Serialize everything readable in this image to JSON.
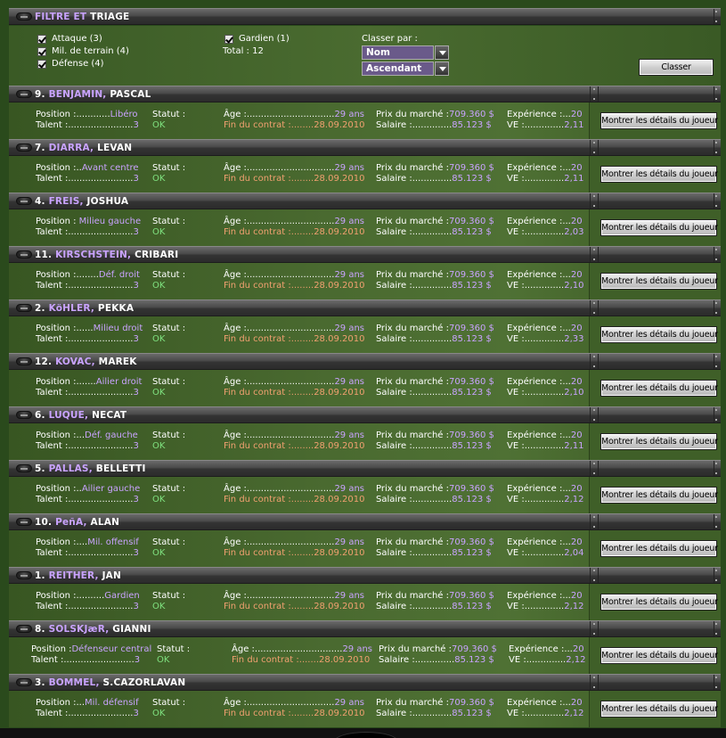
{
  "filter": {
    "title_a": "FILTRE ET",
    "title_b": "TRIAGE",
    "checks": [
      {
        "label": "Attaque (3)"
      },
      {
        "label": "Mil. de terrain (4)"
      },
      {
        "label": "Défense (4)"
      },
      {
        "label": "Gardien (1)"
      }
    ],
    "total": "Total : 12",
    "sort_label": "Classer par :",
    "sort_by": "Nom",
    "sort_order": "Ascendant",
    "sort_button": "Classer"
  },
  "details_button": "Montrer les détails du joueur",
  "players": [
    {
      "num": "9.",
      "last": "BENJAMIN,",
      "first": "PASCAL",
      "position": "Position :............Libéro",
      "talent": "Talent :.......................3",
      "statut_label": "Statut :",
      "statut": "OK",
      "age": "Âge :...............................29 ans",
      "contract": "Fin du contrat :........28.09.2010",
      "price": "Prix du marché :709.360 $",
      "salary": "Salaire :..............85.123 $",
      "exp": "Expérience :...20",
      "ve": "VE :..............2,11"
    },
    {
      "num": "7.",
      "last": "DIARRA,",
      "first": "LEVAN",
      "position": "Position :..Avant centre",
      "talent": "Talent :.......................3",
      "statut_label": "Statut :",
      "statut": "OK",
      "age": "Âge :...............................29 ans",
      "contract": "Fin du contrat :........28.09.2010",
      "price": "Prix du marché :709.360 $",
      "salary": "Salaire :..............85.123 $",
      "exp": "Expérience :...20",
      "ve": "VE :..............2,11"
    },
    {
      "num": "4.",
      "last": "FREIS,",
      "first": "JOSHUA",
      "position": "Position : Milieu gauche",
      "talent": "Talent :.......................3",
      "statut_label": "Statut :",
      "statut": "OK",
      "age": "Âge :...............................29 ans",
      "contract": "Fin du contrat :........28.09.2010",
      "price": "Prix du marché :709.360 $",
      "salary": "Salaire :..............85.123 $",
      "exp": "Expérience :...20",
      "ve": "VE :..............2,03"
    },
    {
      "num": "11.",
      "last": "KIRSCHSTEIN,",
      "first": "CRIBARI",
      "position": "Position :........Déf. droit",
      "talent": "Talent :.......................3",
      "statut_label": "Statut :",
      "statut": "OK",
      "age": "Âge :...............................29 ans",
      "contract": "Fin du contrat :........28.09.2010",
      "price": "Prix du marché :709.360 $",
      "salary": "Salaire :..............85.123 $",
      "exp": "Expérience :...20",
      "ve": "VE :..............2,10"
    },
    {
      "num": "2.",
      "last": "KöHLER,",
      "first": "PEKKA",
      "position": "Position :......Milieu droit",
      "talent": "Talent :.......................3",
      "statut_label": "Statut :",
      "statut": "OK",
      "age": "Âge :...............................29 ans",
      "contract": "Fin du contrat :........28.09.2010",
      "price": "Prix du marché :709.360 $",
      "salary": "Salaire :..............85.123 $",
      "exp": "Expérience :...20",
      "ve": "VE :..............2,33"
    },
    {
      "num": "12.",
      "last": "KOVAC,",
      "first": "MAREK",
      "position": "Position :.......Ailier droit",
      "talent": "Talent :.......................3",
      "statut_label": "Statut :",
      "statut": "OK",
      "age": "Âge :...............................29 ans",
      "contract": "Fin du contrat :........28.09.2010",
      "price": "Prix du marché :709.360 $",
      "salary": "Salaire :..............85.123 $",
      "exp": "Expérience :...20",
      "ve": "VE :..............2,10"
    },
    {
      "num": "6.",
      "last": "LUQUE,",
      "first": "NECAT",
      "position": "Position :...Déf. gauche",
      "talent": "Talent :.......................3",
      "statut_label": "Statut :",
      "statut": "OK",
      "age": "Âge :...............................29 ans",
      "contract": "Fin du contrat :........28.09.2010",
      "price": "Prix du marché :709.360 $",
      "salary": "Salaire :..............85.123 $",
      "exp": "Expérience :...20",
      "ve": "VE :..............2,11"
    },
    {
      "num": "5.",
      "last": "PALLAS,",
      "first": "BELLETTI",
      "position": "Position :..Ailier gauche",
      "talent": "Talent :.......................3",
      "statut_label": "Statut :",
      "statut": "OK",
      "age": "Âge :...............................29 ans",
      "contract": "Fin du contrat :........28.09.2010",
      "price": "Prix du marché :709.360 $",
      "salary": "Salaire :..............85.123 $",
      "exp": "Expérience :...20",
      "ve": "VE :..............2,12"
    },
    {
      "num": "10.",
      "last": "PeñA,",
      "first": "ALAN",
      "position": "Position :....Mil. offensif",
      "talent": "Talent :.......................3",
      "statut_label": "Statut :",
      "statut": "OK",
      "age": "Âge :...............................29 ans",
      "contract": "Fin du contrat :........28.09.2010",
      "price": "Prix du marché :709.360 $",
      "salary": "Salaire :..............85.123 $",
      "exp": "Expérience :...20",
      "ve": "VE :..............2,04"
    },
    {
      "num": "1.",
      "last": "REITHER,",
      "first": "JAN",
      "position": "Position :..........Gardien",
      "talent": "Talent :.......................3",
      "statut_label": "Statut :",
      "statut": "OK",
      "age": "Âge :...............................29 ans",
      "contract": "Fin du contrat :........28.09.2010",
      "price": "Prix du marché :709.360 $",
      "salary": "Salaire :..............85.123 $",
      "exp": "Expérience :...20",
      "ve": "VE :..............2,12"
    },
    {
      "num": "8.",
      "last": "SOLSKJæR,",
      "first": "GIANNI",
      "position": "Position :Défenseur central",
      "talent": "Talent :.........................3",
      "statut_label": "Statut :",
      "statut": "OK",
      "age": "Âge :...............................29 ans",
      "contract": "Fin du contrat :.......28.09.2010",
      "price": "Prix du marché :709.360 $",
      "salary": "Salaire :..............85.123 $",
      "exp": "Expérience :...20",
      "ve": "VE :..............2,12"
    },
    {
      "num": "3.",
      "last": "BOMMEL,",
      "first": "S.CAZORLAVAN",
      "position": "Position :...Mil. défensif",
      "talent": "Talent :.......................3",
      "statut_label": "Statut :",
      "statut": "OK",
      "age": "Âge :...............................29 ans",
      "contract": "Fin du contrat :........28.09.2010",
      "price": "Prix du marché :709.360 $",
      "salary": "Salaire :..............85.123 $",
      "exp": "Expérience :...20",
      "ve": "VE :..............2,12"
    }
  ]
}
